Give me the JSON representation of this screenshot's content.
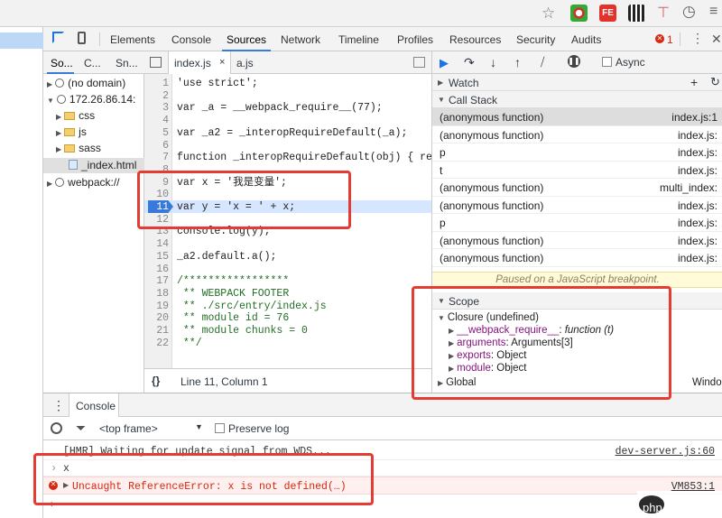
{
  "devtools": {
    "tabs": [
      "Elements",
      "Console",
      "Sources",
      "Network",
      "Timeline",
      "Profiles",
      "Resources",
      "Security",
      "Audits"
    ],
    "error_count": "1"
  },
  "navigator": {
    "tabs": [
      "So...",
      "C...",
      "Sn..."
    ],
    "tree": [
      "(no domain)",
      "172.26.86.14:",
      "css",
      "js",
      "sass",
      "_index.html",
      "webpack://"
    ]
  },
  "editor": {
    "tabs": [
      "index.js",
      "a.js"
    ],
    "status": "Line 11, Column 1",
    "lines": [
      {
        "n": "1",
        "t": "'use strict';"
      },
      {
        "n": "2",
        "t": ""
      },
      {
        "n": "3",
        "t": "var _a = __webpack_require__(77);"
      },
      {
        "n": "4",
        "t": ""
      },
      {
        "n": "5",
        "t": "var _a2 = _interopRequireDefault(_a);"
      },
      {
        "n": "6",
        "t": ""
      },
      {
        "n": "7",
        "t": "function _interopRequireDefault(obj) { re"
      },
      {
        "n": "8",
        "t": ""
      },
      {
        "n": "9",
        "t": "var x = '我是变量';"
      },
      {
        "n": "10",
        "t": ""
      },
      {
        "n": "11",
        "t": "var y = 'x = ' + x;"
      },
      {
        "n": "12",
        "t": ""
      },
      {
        "n": "13",
        "t": "console.log(y);"
      },
      {
        "n": "14",
        "t": ""
      },
      {
        "n": "15",
        "t": "_a2.default.a();"
      },
      {
        "n": "16",
        "t": ""
      },
      {
        "n": "17",
        "t": "/*****************"
      },
      {
        "n": "18",
        "t": " ** WEBPACK FOOTER"
      },
      {
        "n": "19",
        "t": " ** ./src/entry/index.js"
      },
      {
        "n": "20",
        "t": " ** module id = 76"
      },
      {
        "n": "21",
        "t": " ** module chunks = 0"
      },
      {
        "n": "22",
        "t": " **/"
      }
    ]
  },
  "debugger": {
    "async_label": "Async",
    "watch_title": "Watch",
    "callstack_title": "Call Stack",
    "frames": [
      {
        "fn": "(anonymous function)",
        "loc": "index.js:1"
      },
      {
        "fn": "(anonymous function)",
        "loc": "index.js:"
      },
      {
        "fn": "p",
        "loc": "index.js:"
      },
      {
        "fn": "t",
        "loc": "index.js:"
      },
      {
        "fn": "(anonymous function)",
        "loc": "multi_index:"
      },
      {
        "fn": "(anonymous function)",
        "loc": "index.js:"
      },
      {
        "fn": "p",
        "loc": "index.js:"
      },
      {
        "fn": "(anonymous function)",
        "loc": "index.js:"
      },
      {
        "fn": "(anonymous function)",
        "loc": "index.js:"
      }
    ],
    "paused_text": "Paused on a JavaScript breakpoint.",
    "scope_title": "Scope",
    "closure": "Closure (undefined)",
    "scope_items": [
      {
        "k": "__webpack_require__",
        "v": "function (t)"
      },
      {
        "k": "arguments",
        "v": "Arguments[3]"
      },
      {
        "k": "exports",
        "v": "Object"
      },
      {
        "k": "module",
        "v": "Object"
      }
    ],
    "global": "Global",
    "global_val": "Windo"
  },
  "console": {
    "tab": "Console",
    "context": "<top frame>",
    "preserve_log": "Preserve log",
    "messages": [
      {
        "text": "[HMR] Waiting for update signal from WDS...",
        "src": "dev-server.js:60"
      },
      {
        "text": "x",
        "src": ""
      },
      {
        "text": "Uncaught ReferenceError: x is not defined(…)",
        "src": "VM853:1"
      }
    ]
  },
  "watermark": "php 中文网",
  "colors": {
    "accent": "#1a73e8",
    "error": "#d8270d",
    "highlight": "#e53b32",
    "exec_line": "#d6e6ff"
  }
}
